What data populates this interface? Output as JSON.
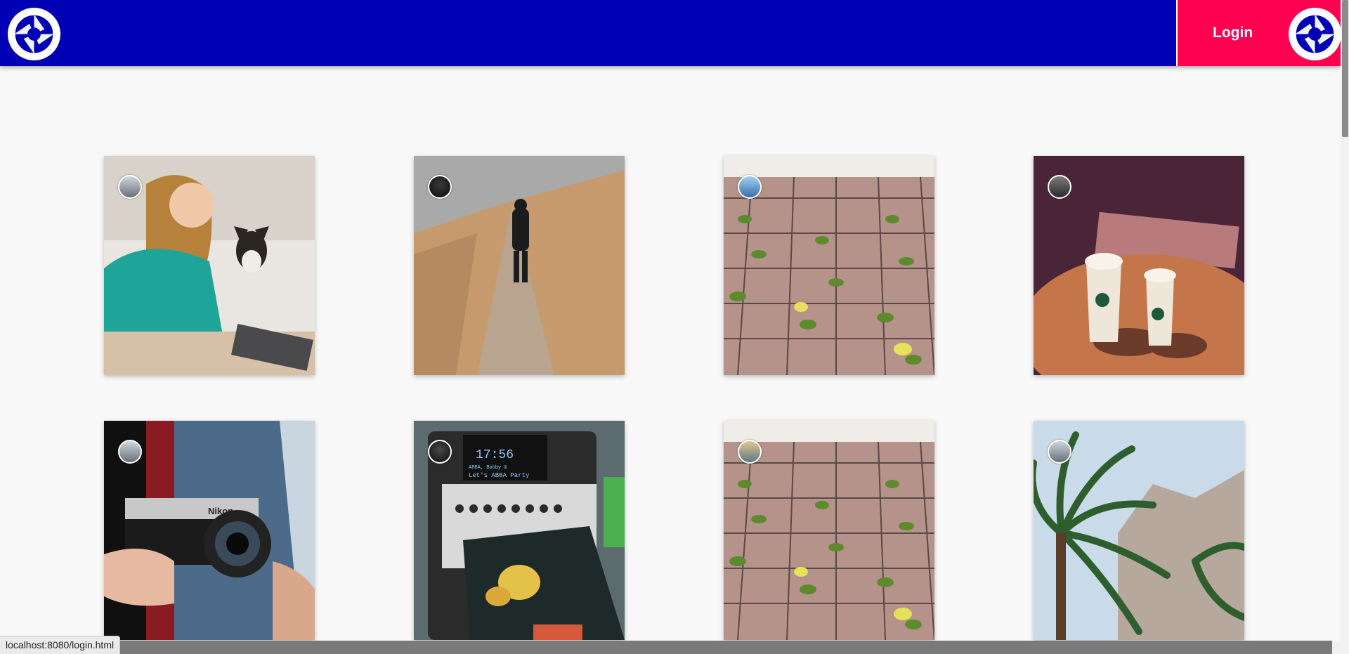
{
  "header": {
    "bg_color": "#0000b5",
    "logo_left_icon": "camera-shutter-icon",
    "logo_right_icon": "camera-shutter-icon",
    "login_label": "Login",
    "login_color": "#ff0050"
  },
  "gallery": {
    "cards": [
      {
        "subject": "woman-with-headphones-laptop-and-dog",
        "avatar": "user-avatar-1"
      },
      {
        "subject": "hiker-on-mountain-trail",
        "avatar": "user-avatar-2"
      },
      {
        "subject": "vines-on-trellis",
        "avatar": "user-avatar-3"
      },
      {
        "subject": "two-coffee-cups-on-table",
        "avatar": "user-avatar-4"
      },
      {
        "subject": "hands-holding-nikon-camera",
        "avatar": "user-avatar-5"
      },
      {
        "subject": "radio-display-with-snack",
        "avatar": "user-avatar-6"
      },
      {
        "subject": "vines-on-trellis",
        "avatar": "user-avatar-7"
      },
      {
        "subject": "palm-trees-and-mountain",
        "avatar": "user-avatar-8"
      }
    ],
    "radio_time": "17:56",
    "radio_line1": "ABBA, Bobby &",
    "radio_line2": "Let's ABBA Party",
    "camera_brand": "Nikon"
  },
  "status_bar": {
    "url": "localhost:8080/login.html"
  }
}
